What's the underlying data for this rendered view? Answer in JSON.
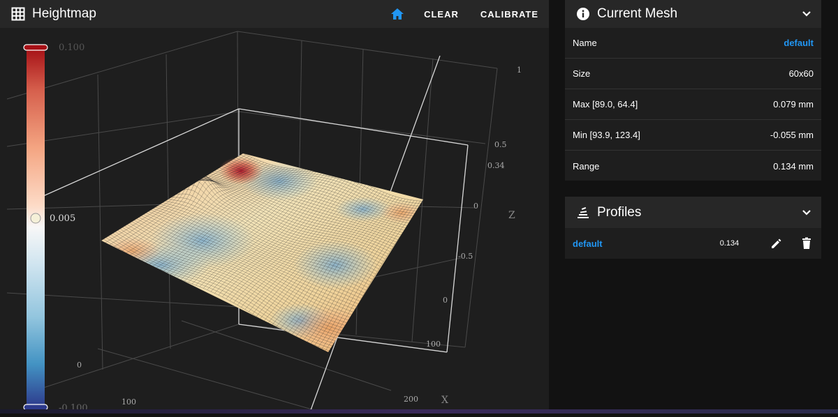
{
  "heightmap": {
    "title": "Heightmap",
    "icons": {
      "title": "grid-icon",
      "home": "home-icon"
    },
    "buttons": {
      "clear": "CLEAR",
      "calibrate": "CALIBRATE"
    }
  },
  "chart_data": {
    "type": "surface",
    "colorscale": {
      "max_label": "0.100",
      "mid_label": "0.005",
      "min_label": "-0.100",
      "colors": [
        "#b2182b",
        "#ef8a62",
        "#fddbc7",
        "#f7f7f7",
        "#d1e5f0",
        "#67a9cf",
        "#2166ac",
        "#313695"
      ]
    },
    "axes": {
      "z": {
        "label": "Z",
        "ticks": [
          "1",
          "0.5",
          "0.34",
          "0",
          "-0.5"
        ]
      },
      "x": {
        "label": "X",
        "ticks": [
          "0",
          "100",
          "200"
        ]
      },
      "y": {
        "ticks": [
          "0",
          "100"
        ]
      }
    },
    "grid": true
  },
  "mesh": {
    "title": "Current Mesh",
    "icons": {
      "header": "info-icon",
      "collapse": "chevron-down-icon"
    },
    "rows": [
      {
        "label": "Name",
        "value": "default",
        "link": true
      },
      {
        "label": "Size",
        "value": "60x60"
      },
      {
        "label": "Max [89.0, 64.4]",
        "value": "0.079 mm"
      },
      {
        "label": "Min [93.9, 123.4]",
        "value": "-0.055 mm"
      },
      {
        "label": "Range",
        "value": "0.134 mm"
      }
    ]
  },
  "profiles": {
    "title": "Profiles",
    "icons": {
      "header": "layers-icon",
      "collapse": "chevron-down-icon",
      "edit": "pencil-icon",
      "delete": "trash-icon"
    },
    "items": [
      {
        "name": "default",
        "value": "0.134"
      }
    ]
  }
}
